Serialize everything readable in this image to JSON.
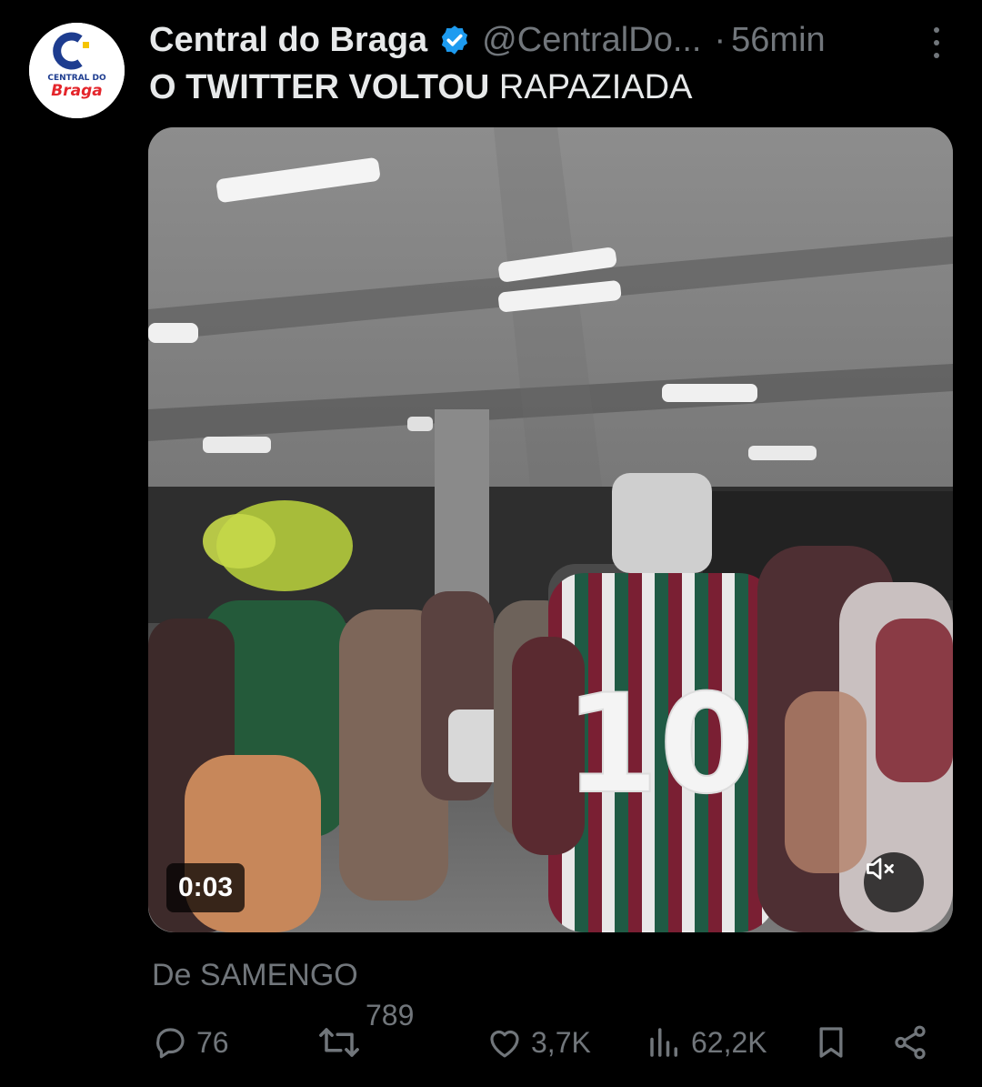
{
  "tweet": {
    "author_name": "Central do Braga",
    "handle": "@CentralDo...",
    "separator": "·",
    "time": "56min",
    "text_bold": "O TWITTER VOLTOU",
    "text_rest": " RAPAZIADA",
    "avatar": {
      "logo_line1": "CENTRAL DO",
      "logo_line2": "Braga",
      "brand_red": "#e4252b",
      "brand_blue": "#1d3c8f",
      "brand_yellow": "#f5c400"
    },
    "verified_color": "#1d9bf0"
  },
  "media": {
    "duration": "0:03",
    "jersey_number": "10",
    "mute_icon": "speaker-muted-icon"
  },
  "source_text": "De SAMENGO",
  "actions": {
    "replies": "76",
    "retweets": "789",
    "likes": "3,7K",
    "views": "62,2K"
  },
  "colors": {
    "background": "#000000",
    "text_primary": "#e7e9ea",
    "text_secondary": "#71767b"
  }
}
